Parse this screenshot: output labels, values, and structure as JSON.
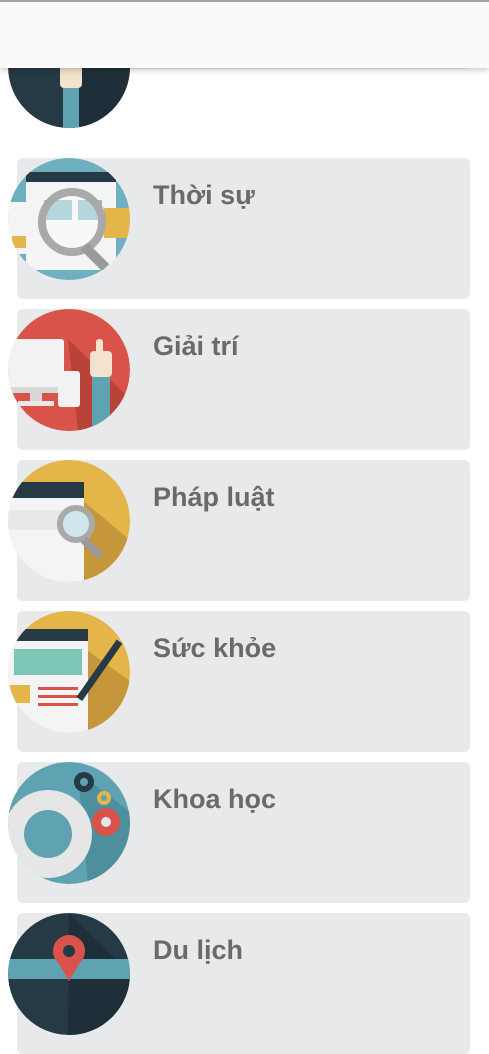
{
  "categories": [
    {
      "label": "",
      "icon": "hand-pointer-icon",
      "color": "#263a46"
    },
    {
      "label": "Thời sự",
      "icon": "magnifier-news-icon",
      "color": "#6fb0c0"
    },
    {
      "label": "Giải trí",
      "icon": "devices-touch-icon",
      "color": "#d9534a"
    },
    {
      "label": "Pháp luật",
      "icon": "search-document-icon",
      "color": "#e4b548"
    },
    {
      "label": "Sức khỏe",
      "icon": "pen-document-icon",
      "color": "#e4b548"
    },
    {
      "label": "Khoa học",
      "icon": "gears-icon",
      "color": "#5fa3b2"
    },
    {
      "label": "Du lịch",
      "icon": "map-pin-icon",
      "color": "#263a46"
    }
  ]
}
